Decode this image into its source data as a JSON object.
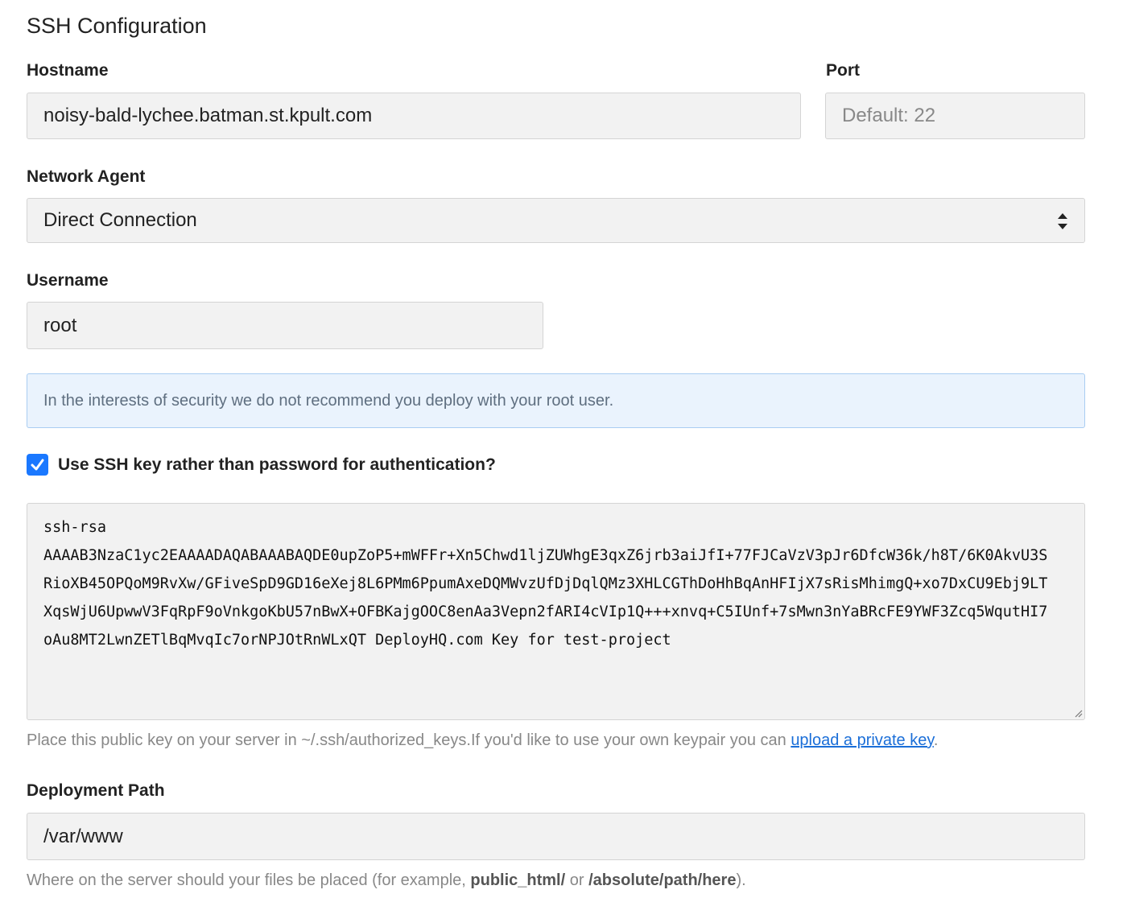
{
  "section": {
    "title": "SSH Configuration"
  },
  "hostname": {
    "label": "Hostname",
    "value": "noisy-bald-lychee.batman.st.kpult.com"
  },
  "port": {
    "label": "Port",
    "placeholder": "Default: 22"
  },
  "network_agent": {
    "label": "Network Agent",
    "selected": "Direct Connection"
  },
  "username": {
    "label": "Username",
    "value": "root"
  },
  "notice": {
    "text": "In the interests of security we do not recommend you deploy with your root user."
  },
  "ssh_key": {
    "checkbox_label": "Use SSH key rather than password for authentication?",
    "checked": true,
    "key_lines": [
      "ssh-rsa",
      "AAAAB3NzaC1yc2EAAAADAQABAAABAQDE0upZoP5+mWFFr+Xn5Chwd1ljZUWhgE3qxZ6jrb3aiJfI+77FJCaVzV3pJr6DfcW36k/h8T/6K0AkvU3S",
      "RioXB45OPQoM9RvXw/GFiveSpD9GD16eXej8L6PMm6PpumAxeDQMWvzUfDjDqlQMz3XHLCGThDoHhBqAnHFIjX7sRisMhimgQ+xo7DxCU9Ebj9LT",
      "XqsWjU6UpwwV3FqRpF9oVnkgoKbU57nBwX+OFBKajgOOC8enAa3Vepn2fARI4cVIp1Q+++xnvq+C5IUnf+7sMwn3nYaBRcFE9YWF3Zcq5WqutHI7",
      "oAu8MT2LwnZETlBqMvqIc7orNPJOtRnWLxQT DeployHQ.com Key for test-project"
    ],
    "help_prefix": "Place this public key on your server in ~/.ssh/authorized_keys.If you'd like to use your own keypair you can ",
    "help_link": "upload a private key",
    "help_suffix": "."
  },
  "deployment_path": {
    "label": "Deployment Path",
    "value": "/var/www",
    "help_prefix": "Where on the server should your files be placed (for example, ",
    "help_example_1": "public_html/",
    "help_or": " or ",
    "help_example_2": "/absolute/path/here",
    "help_suffix": ")."
  },
  "colors": {
    "accent": "#1a78ff",
    "link": "#1a6ed8",
    "info_bg": "#eaf3fd",
    "info_border": "#a9cdf2",
    "field_bg": "#f2f2f2"
  }
}
